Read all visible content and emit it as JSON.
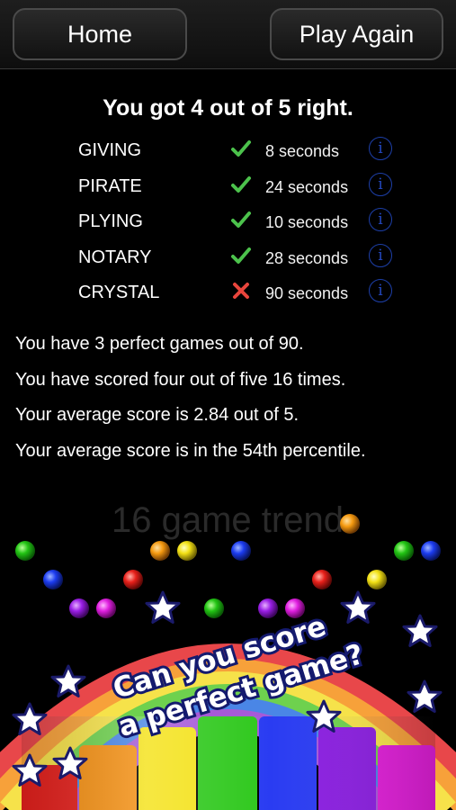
{
  "header": {
    "home_label": "Home",
    "play_again_label": "Play Again"
  },
  "result": {
    "title": "You got 4 out of 5 right.",
    "words": [
      {
        "word": "GIVING",
        "correct": true,
        "time": "8 seconds"
      },
      {
        "word": "PIRATE",
        "correct": true,
        "time": "24 seconds"
      },
      {
        "word": "PLYING",
        "correct": true,
        "time": "10 seconds"
      },
      {
        "word": "NOTARY",
        "correct": true,
        "time": "28 seconds"
      },
      {
        "word": "CRYSTAL",
        "correct": false,
        "time": "90 seconds"
      }
    ],
    "info_icon": "i"
  },
  "stats": [
    "You have 3 perfect games out of 90.",
    "You have scored four out of five 16 times.",
    "Your average score is 2.84 out of 5.",
    "Your average score is in the 54th percentile."
  ],
  "trend": {
    "title": "16 game trend"
  },
  "promo": {
    "line1": "Can you score",
    "line2": "a perfect game?"
  },
  "colors": {
    "check": "#4cc24c",
    "cross": "#e8453c",
    "info": "#1d3fa8"
  }
}
